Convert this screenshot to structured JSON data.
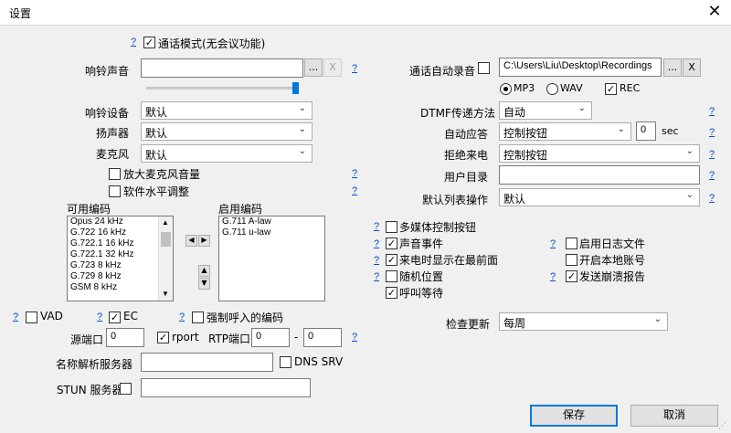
{
  "window": {
    "title": "设置"
  },
  "header": {
    "call_mode_label": "通话模式(无会议功能)"
  },
  "help": "?",
  "ringtone": {
    "label": "响铃声音",
    "value": "",
    "browse": "...",
    "clear": "X"
  },
  "devices": {
    "ring_label": "响铃设备",
    "ring_value": "默认",
    "speaker_label": "扬声器",
    "speaker_value": "默认",
    "mic_label": "麦克风",
    "mic_value": "默认"
  },
  "mic_options": {
    "amplify_label": "放大麦克风音量",
    "software_level_label": "软件水平调整"
  },
  "codecs": {
    "available_label": "可用编码",
    "available": [
      "Opus 24 kHz",
      "G.722 16 kHz",
      "G.722.1 16 kHz",
      "G.722.1 32 kHz",
      "G.723 8 kHz",
      "G.729 8 kHz",
      "GSM 8 kHz"
    ],
    "enabled_label": "启用编码",
    "enabled": [
      "G.711 A-law",
      "G.711 u-law"
    ]
  },
  "audio_opts": {
    "vad_label": "VAD",
    "ec_label": "EC",
    "force_codec_label": "强制呼入的编码"
  },
  "ports": {
    "source_port_label": "源端口",
    "source_port_value": "0",
    "rport_label": "rport",
    "rtp_label": "RTP端口",
    "rtp_from": "0",
    "rtp_to": "0",
    "dash": "-"
  },
  "name_server": {
    "label": "名称解析服务器",
    "value": "",
    "dns_srv_label": "DNS SRV"
  },
  "stun": {
    "label": "STUN 服务器",
    "value": ""
  },
  "recording": {
    "label": "通话自动录音",
    "path": "C:\\Users\\Liu\\Desktop\\Recordings",
    "browse": "...",
    "clear": "X",
    "mp3": "MP3",
    "wav": "WAV",
    "rec": "REC"
  },
  "dtmf": {
    "label": "DTMF传递方法",
    "value": "自动"
  },
  "auto_answer": {
    "label": "自动应答",
    "value": "控制按钮",
    "seconds": "0",
    "unit": "sec"
  },
  "reject": {
    "label": "拒绝来电",
    "value": "控制按钮"
  },
  "user_dir": {
    "label": "用户目录",
    "value": ""
  },
  "list_action": {
    "label": "默认列表操作",
    "value": "默认"
  },
  "flags_left": [
    {
      "label": "多媒体控制按钮",
      "checked": false
    },
    {
      "label": "声音事件",
      "checked": true
    },
    {
      "label": "来电时显示在最前面",
      "checked": true
    },
    {
      "label": "随机位置",
      "checked": false
    },
    {
      "label": "呼叫等待",
      "checked": true
    }
  ],
  "flags_right": [
    {
      "label": "启用日志文件",
      "checked": false
    },
    {
      "label": "开启本地账号",
      "checked": false
    },
    {
      "label": "发送崩溃报告",
      "checked": true
    }
  ],
  "updates": {
    "label": "检查更新",
    "value": "每周"
  },
  "buttons": {
    "save": "保存",
    "cancel": "取消"
  }
}
